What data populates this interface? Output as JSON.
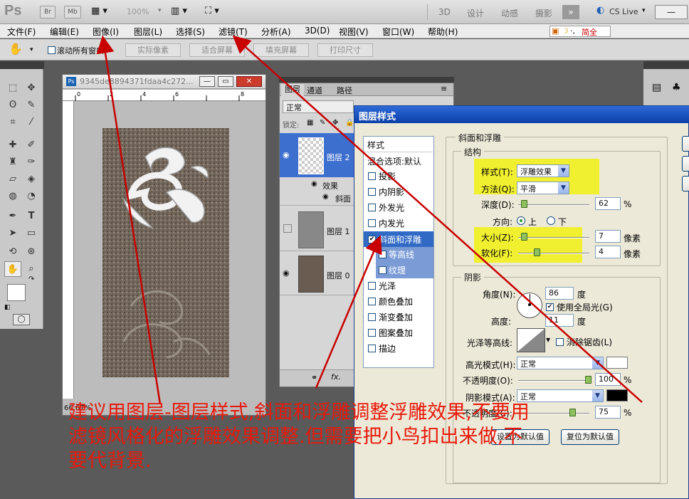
{
  "appbar": {
    "logo": "Ps",
    "br": "Br",
    "mb": "Mb",
    "zoom": "100%",
    "workspaces": [
      "3D",
      "设计",
      "动感",
      "摄影"
    ],
    "cslive": "CS Live"
  },
  "menu": [
    "文件(F)",
    "编辑(E)",
    "图像(I)",
    "图层(L)",
    "选择(S)",
    "滤镜(T)",
    "分析(A)",
    "3D(D)",
    "视图(V)",
    "窗口(W)",
    "帮助(H)"
  ],
  "ime": "简全",
  "options": {
    "scroll_all": "滚动所有窗口",
    "buttons": [
      "实际像素",
      "适合屏幕",
      "填充屏幕",
      "打印尺寸"
    ]
  },
  "document": {
    "title": "9345de8894371fdaa4c272...",
    "zoom": "66.67%"
  },
  "layers_panel": {
    "tabs": [
      "图层",
      "通道",
      "路径"
    ],
    "blend": "正常",
    "lock_label": "锁定:",
    "layers": [
      {
        "name": "图层 2",
        "effects_label": "效果",
        "effect_item": "斜面"
      },
      {
        "name": "图层 1"
      },
      {
        "name": "图层 0"
      }
    ]
  },
  "dialog": {
    "title": "图层样式",
    "styles_header": "样式",
    "blend_options": "混合选项:默认",
    "styles": [
      "投影",
      "内阴影",
      "外发光",
      "内发光",
      "斜面和浮雕",
      "等高线",
      "纹理",
      "光泽",
      "颜色叠加",
      "渐变叠加",
      "图案叠加",
      "描边"
    ],
    "section_title": "斜面和浮雕",
    "structure_label": "结构",
    "style_label": "样式(T):",
    "style_value": "浮雕效果",
    "technique_label": "方法(Q):",
    "technique_value": "平滑",
    "depth_label": "深度(D):",
    "depth_value": "62",
    "percent": "%",
    "direction_label": "方向:",
    "dir_up": "上",
    "dir_down": "下",
    "size_label": "大小(Z):",
    "size_value": "7",
    "soften_label": "软化(F):",
    "soften_value": "4",
    "px": "像素",
    "shading_label": "阴影",
    "angle_label": "角度(N):",
    "angle_value": "86",
    "deg": "度",
    "global_light": "使用全局光(G)",
    "altitude_label": "高度:",
    "altitude_value": "11",
    "gloss_label": "光泽等高线:",
    "antialias": "消除锯齿(L)",
    "highlight_label": "高光模式(H):",
    "highlight_value": "正常",
    "opacity1_label": "不透明度(O):",
    "opacity1_value": "100",
    "shadow_label": "阴影模式(A):",
    "shadow_value": "正常",
    "opacity2_label": "不透明度(C):",
    "opacity2_value": "75",
    "btn_default": "设置为默认值",
    "btn_reset": "复位为默认值",
    "highlight_color": "#ffffff",
    "shadow_color": "#000000"
  },
  "annotation": {
    "line1": "建议用图层-图层样式,斜面和浮雕调整浮雕效果,不要用",
    "line2": "滤镜风格化的浮雕效果调整.但需要把小鸟扣出来做,不",
    "line3": "要代背景."
  }
}
